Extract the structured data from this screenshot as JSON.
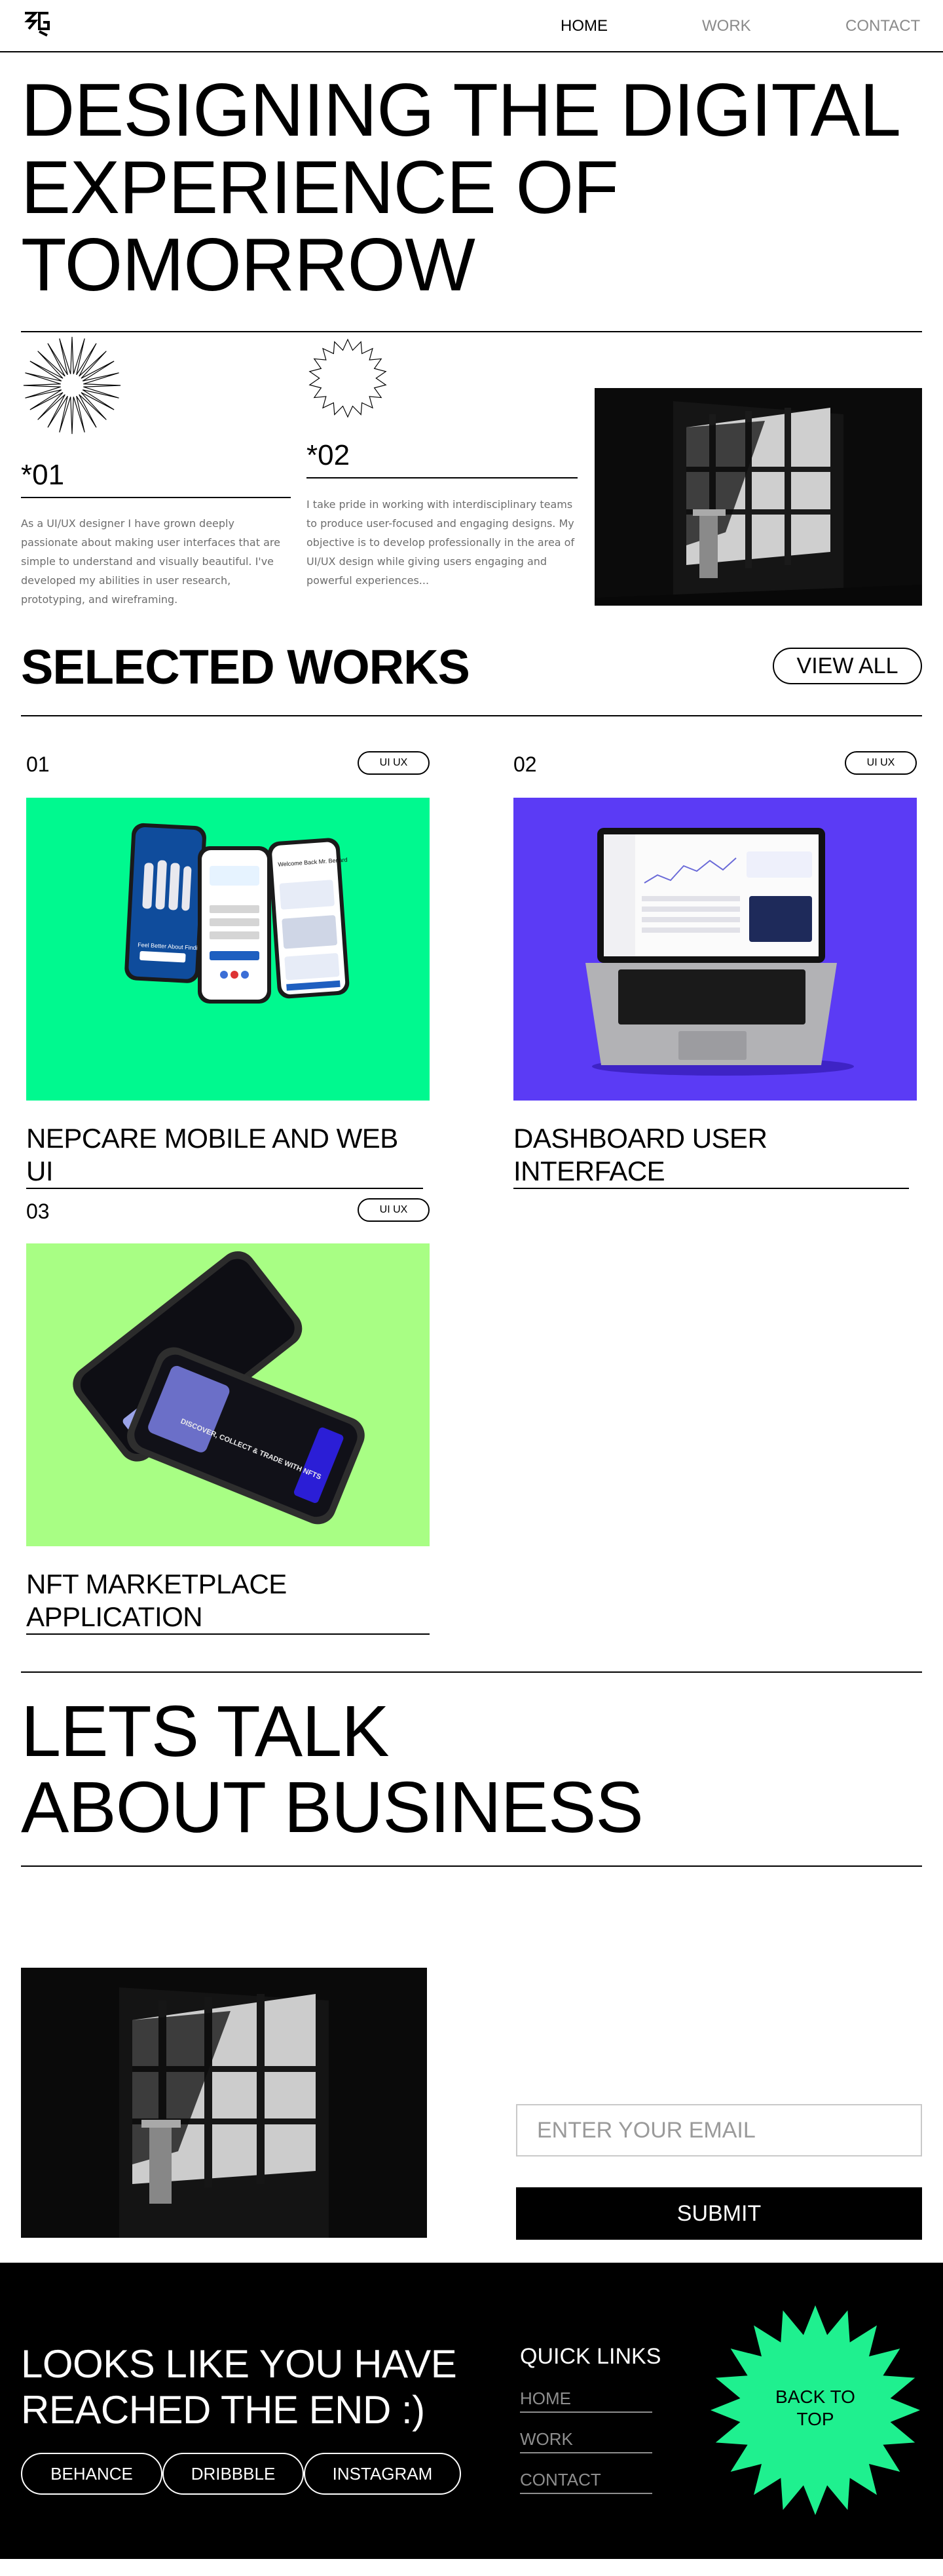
{
  "nav": {
    "logo": "SG",
    "links": [
      "HOME",
      "WORK",
      "CONTACT"
    ]
  },
  "hero": {
    "line1": "DESIGNING THE DIGITAL",
    "line2": "EXPERIENCE OF",
    "line3": "TOMORROW"
  },
  "intro": {
    "n1": "*01",
    "t1": "As a UI/UX designer I have grown deeply passionate about making user interfaces that are simple to understand and visually beautiful. I've developed my abilities in user research, prototyping, and wireframing.",
    "n2": "*02",
    "t2": "I take pride in working with interdisciplinary teams to produce user-focused and engaging designs. My objective is to develop professionally in the area of UI/UX design while giving users engaging and powerful experiences..."
  },
  "works": {
    "title": "SELECTED WORKS",
    "view_all": "VIEW ALL",
    "items": [
      {
        "num": "01",
        "tag": "UI UX",
        "title": "NEPCARE MOBILE AND WEB UI",
        "bg": "#00f98f",
        "screen_text": "Feel Better About Finding Healthcare",
        "screen_text2": "Welcome Back Mr. Benard"
      },
      {
        "num": "02",
        "tag": "UI UX",
        "title": "DASHBOARD USER INTERFACE",
        "bg": "#5b3bf5"
      },
      {
        "num": "03",
        "tag": "UI UX",
        "title": "NFT MARKETPLACE APPLICATION",
        "title_l1": "NFT MARKETPLACE",
        "title_l2": "APPLICATION",
        "bg": "#a8fe84",
        "screen_text": "DISCOVER, COLLECT & TRADE WITH NFTS"
      }
    ]
  },
  "contact": {
    "l1": "LETS TALK",
    "l2": "ABOUT BUSINESS",
    "email_placeholder": "ENTER YOUR EMAIL",
    "submit": "SUBMIT"
  },
  "footer": {
    "l1": "LOOKS LIKE YOU HAVE",
    "l2": "REACHED THE END :)",
    "socials": [
      "BEHANCE",
      "DRIBBBLE",
      "INSTAGRAM"
    ],
    "quick_title": "QUICK LINKS",
    "quick_links": [
      "HOME",
      "WORK",
      "CONTACT"
    ],
    "back1": "BACK TO",
    "back2": "TOP",
    "badge_color": "#1ff08f"
  }
}
